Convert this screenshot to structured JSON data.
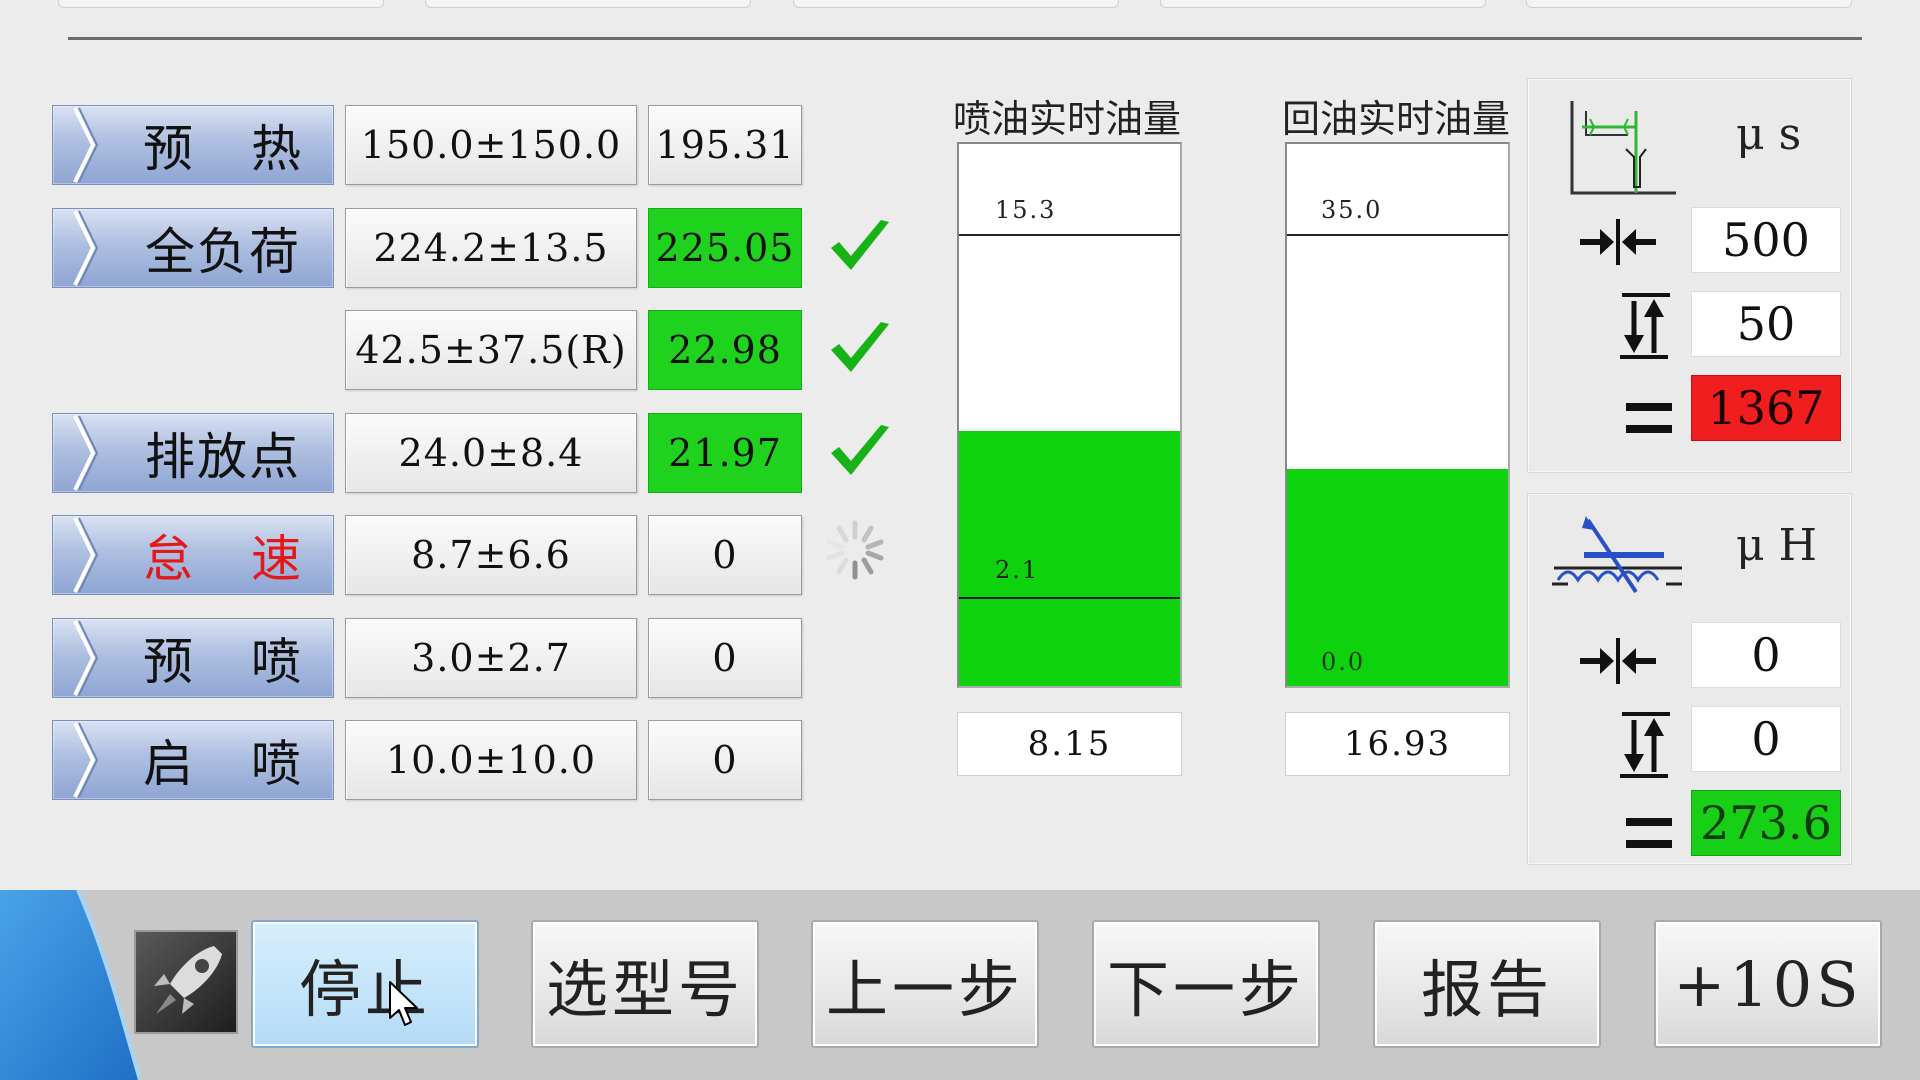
{
  "steps": [
    {
      "label_a": "预",
      "label_b": "热",
      "range": "150.0±150.0",
      "value": "195.31",
      "status": "none"
    },
    {
      "label": "全负荷",
      "range": "224.2±13.5",
      "value": "225.05",
      "status": "ok"
    },
    {
      "label": "",
      "range": "42.5±37.5(R)",
      "value": "22.98",
      "status": "ok"
    },
    {
      "label": "排放点",
      "range": "24.0±8.4",
      "value": "21.97",
      "status": "ok"
    },
    {
      "label_a": "怠",
      "label_b": "速",
      "range": "8.7±6.6",
      "value": "0",
      "status": "loading"
    },
    {
      "label_a": "预",
      "label_b": "喷",
      "range": "3.0±2.7",
      "value": "0",
      "status": "none"
    },
    {
      "label_a": "启",
      "label_b": "喷",
      "range": "10.0±10.0",
      "value": "0",
      "status": "none"
    }
  ],
  "injection_bar": {
    "title": "喷油实时油量",
    "upper_limit": "15.3",
    "lower_limit": "2.1",
    "value": "8.15",
    "fill_fraction": 0.47,
    "upper_fraction": 0.83,
    "lower_fraction": 0.16
  },
  "return_bar": {
    "title": "回油实时油量",
    "upper_limit": "35.0",
    "lower_limit": "0.0",
    "value": "16.93",
    "fill_fraction": 0.4,
    "upper_fraction": 0.83
  },
  "panel_time": {
    "unit": "μ s",
    "input1": "500",
    "input2": "50",
    "result": "1367",
    "result_status": "fail"
  },
  "panel_inductance": {
    "unit": "μ H",
    "input1": "0",
    "input2": "0",
    "result": "273.6",
    "result_status": "pass"
  },
  "toolbar": {
    "buttons": [
      "停止",
      "选型号",
      "上一步",
      "下一步",
      "报告",
      "+10S"
    ],
    "active_index": 0
  },
  "colors": {
    "pass_green": "#1ed21e",
    "fail_red": "#f01e1e",
    "step_blue": "#9fb3dc",
    "idle_red_text": "#e41818"
  }
}
